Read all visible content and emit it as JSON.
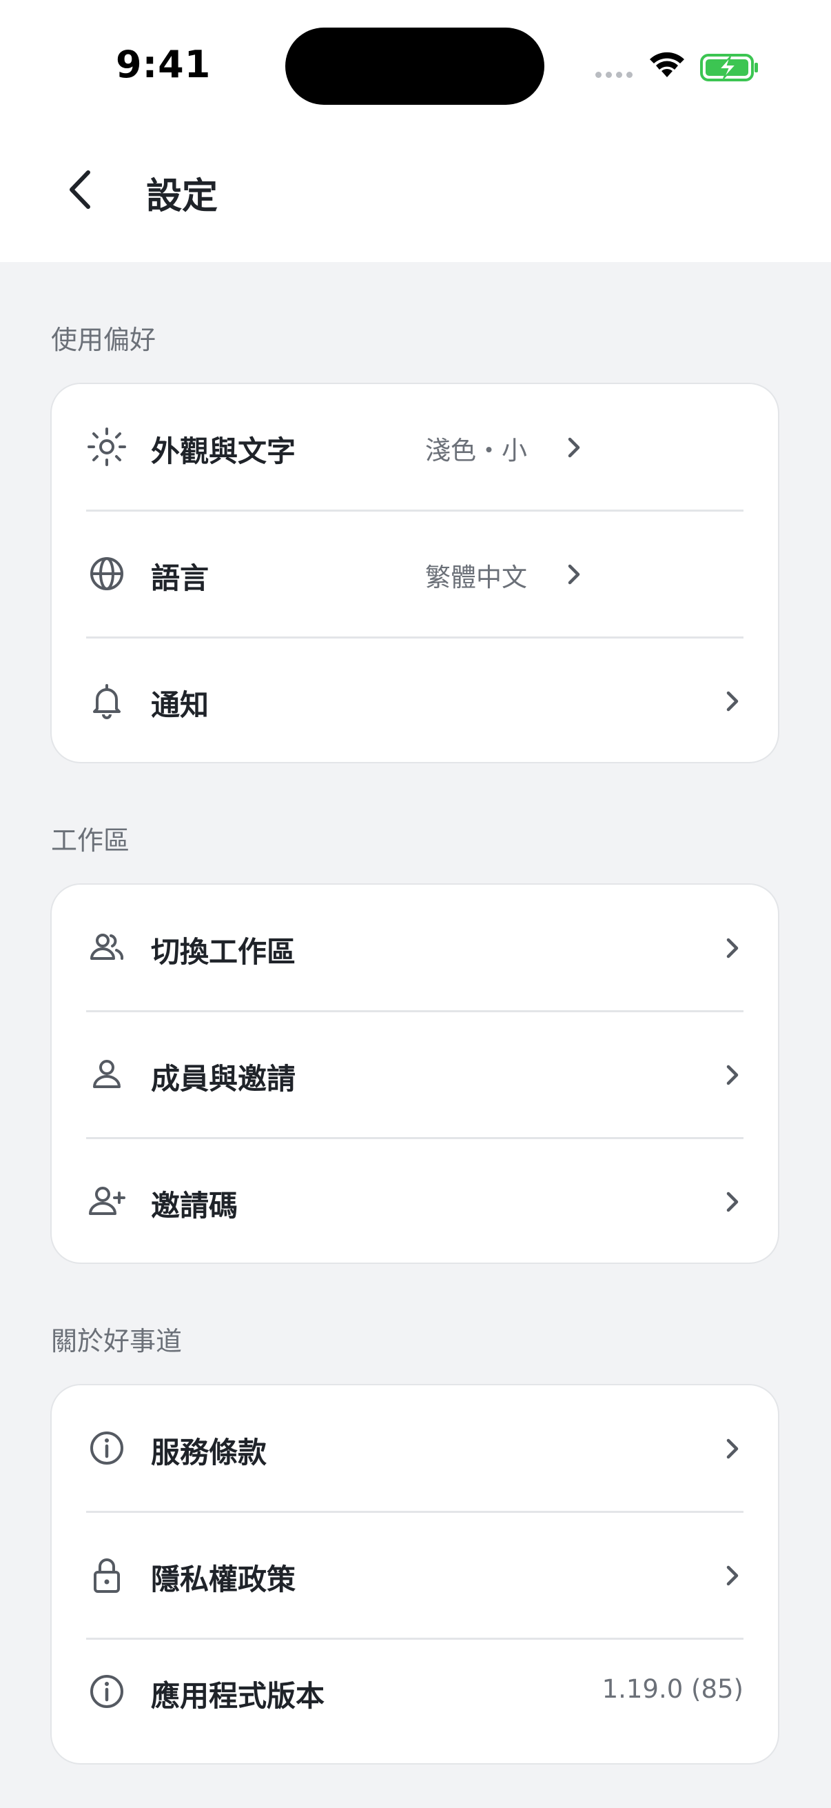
{
  "status_bar": {
    "time": "9:41"
  },
  "header": {
    "title": "設定"
  },
  "sections": [
    {
      "title": "使用偏好",
      "items": [
        {
          "label": "外觀與文字",
          "value": "淺色・小",
          "icon": "sun-icon"
        },
        {
          "label": "語言",
          "value": "繁體中文",
          "icon": "globe-icon"
        },
        {
          "label": "通知",
          "icon": "bell-icon"
        }
      ]
    },
    {
      "title": "工作區",
      "items": [
        {
          "label": "切換工作區",
          "icon": "users-icon"
        },
        {
          "label": "成員與邀請",
          "icon": "user-icon"
        },
        {
          "label": "邀請碼",
          "icon": "user-plus-icon"
        }
      ]
    },
    {
      "title": "關於好事道",
      "items": [
        {
          "label": "服務條款",
          "icon": "info-icon"
        },
        {
          "label": "隱私權政策",
          "icon": "lock-icon"
        },
        {
          "label": "應用程式版本",
          "value": "1.19.0 (85)",
          "icon": "info-icon"
        }
      ]
    }
  ],
  "colors": {
    "background": "#f2f3f5",
    "card": "#ffffff",
    "text": "#1f2329",
    "secondary": "#6b7078",
    "battery_green": "#3cc552"
  }
}
